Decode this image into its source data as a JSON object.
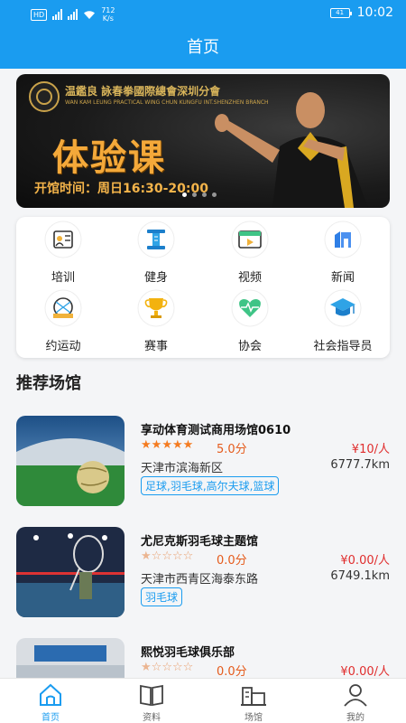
{
  "status_bar": {
    "hd": "HD",
    "net_speed_value": "712",
    "net_speed_unit": "K/s",
    "time": "10:02",
    "battery": "41"
  },
  "header": {
    "title": "首页"
  },
  "banner": {
    "brand_cn": "温鑑良 詠春拳國際總會深圳分會",
    "brand_en": "WAN KAM LEUNG PRACTICAL WING CHUN KUNGFU INT.SHENZHEN BRANCH",
    "headline": "体验课",
    "hours": "开馆时间：周日16:30-20:00"
  },
  "categories": [
    {
      "label": "培训",
      "icon": "training-icon"
    },
    {
      "label": "健身",
      "icon": "fitness-icon"
    },
    {
      "label": "视频",
      "icon": "video-icon"
    },
    {
      "label": "新闻",
      "icon": "news-icon"
    },
    {
      "label": "约运动",
      "icon": "appointment-icon"
    },
    {
      "label": "赛事",
      "icon": "trophy-icon"
    },
    {
      "label": "协会",
      "icon": "heart-icon"
    },
    {
      "label": "社会指导员",
      "icon": "graduation-cap-icon"
    }
  ],
  "section": {
    "title": "推荐场馆"
  },
  "venues": [
    {
      "name": "享动体育测试商用场馆0610",
      "rating": 5.0,
      "score": "5.0分",
      "price": "¥10/人",
      "address": "天津市滨海新区",
      "distance": "6777.7km",
      "tags": "足球,羽毛球,高尔夫球,篮球"
    },
    {
      "name": "尤尼克斯羽毛球主题馆",
      "rating": 0.0,
      "score": "0.0分",
      "price": "¥0.00/人",
      "address": "天津市西青区海泰东路",
      "distance": "6749.1km",
      "tags": "羽毛球"
    },
    {
      "name": "熙悦羽毛球俱乐部",
      "rating": 0.0,
      "score": "0.0分",
      "price": "¥0.00/人",
      "address": "",
      "distance": "",
      "tags": ""
    }
  ],
  "tabs": [
    {
      "label": "首页",
      "icon": "home-icon",
      "active": true
    },
    {
      "label": "资料",
      "icon": "book-icon",
      "active": false
    },
    {
      "label": "场馆",
      "icon": "venue-icon",
      "active": false
    },
    {
      "label": "我的",
      "icon": "user-icon",
      "active": false
    }
  ],
  "colors": {
    "primary": "#1a9cf0",
    "star": "#f47b20",
    "price": "#e02d2d",
    "banner_text": "#f4a93a"
  }
}
